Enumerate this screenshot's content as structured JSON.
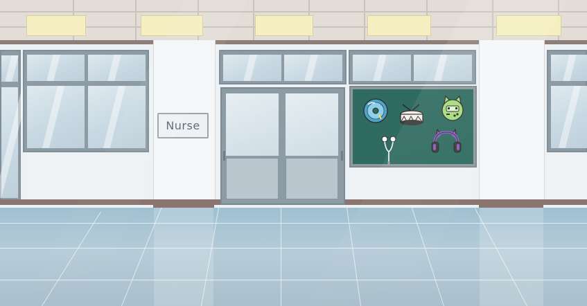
{
  "scene": {
    "name": "school-hallway",
    "nurse_sign_text": "Nurse"
  },
  "bulletin_board": {
    "items": [
      {
        "name": "music-cd"
      },
      {
        "name": "snare-drum"
      },
      {
        "name": "green-cat-game-console"
      },
      {
        "name": "earphones"
      },
      {
        "name": "cat-ear-headphones"
      }
    ]
  },
  "colors": {
    "wall": "#eef1f3",
    "board": "#2f6b60",
    "floor": "#a9c4d2",
    "trim": "#8a7570"
  }
}
